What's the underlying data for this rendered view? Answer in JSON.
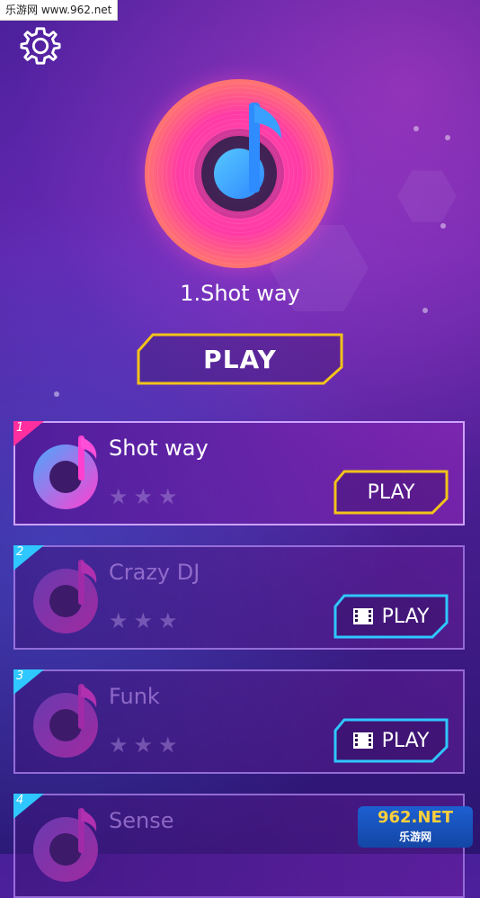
{
  "watermark": {
    "top": "乐游网 www.962.net",
    "bottom_logo": "962.NET",
    "bottom_sub": "乐游网"
  },
  "current_song": {
    "title": "1.Shot way"
  },
  "main_play": {
    "label": "PLAY"
  },
  "colors": {
    "accent_yellow": "#f2c31a",
    "accent_blue": "#2fc7ff",
    "pink": "#ff2fa0"
  },
  "songs": [
    {
      "number": "1",
      "name": "Shot way",
      "stars": "★★★",
      "button": "PLAY",
      "locked": false
    },
    {
      "number": "2",
      "name": "Crazy DJ",
      "stars": "★★★",
      "button": "PLAY",
      "locked": true
    },
    {
      "number": "3",
      "name": "Funk",
      "stars": "★★★",
      "button": "PLAY",
      "locked": true
    },
    {
      "number": "4",
      "name": "Sense",
      "stars": "★★★",
      "button": "",
      "locked": true
    }
  ]
}
